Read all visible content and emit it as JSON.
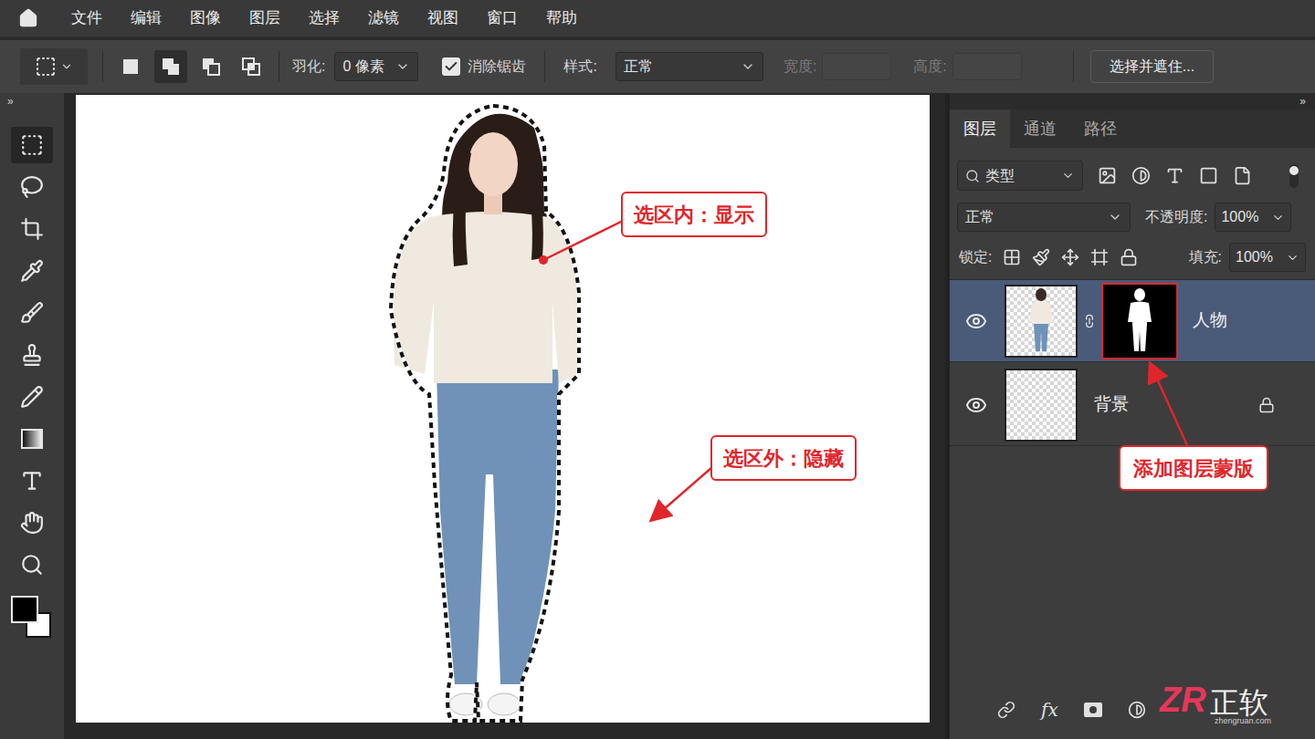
{
  "menu_items": [
    "文件",
    "编辑",
    "图像",
    "图层",
    "选择",
    "滤镜",
    "视图",
    "窗口",
    "帮助"
  ],
  "collapse_glyph": "»",
  "options_bar": {
    "modes": [
      {
        "kind": "new",
        "selected": false
      },
      {
        "kind": "add",
        "selected": true
      },
      {
        "kind": "subtract",
        "selected": false
      },
      {
        "kind": "intersect",
        "selected": false
      }
    ],
    "feather_label": "羽化:",
    "feather_value": "0 像素",
    "antialias": {
      "label": "消除锯齿",
      "checked": true
    },
    "style_label": "样式:",
    "style_value": "正常",
    "width_label": "宽度:",
    "width_disabled": true,
    "height_label": "高度:",
    "height_disabled": true,
    "button": "选择并遮住..."
  },
  "tools": [
    {
      "kind": "marquee",
      "selected": true
    },
    {
      "kind": "lasso",
      "selected": false
    },
    {
      "kind": "crop",
      "selected": false
    },
    {
      "kind": "eyedropper",
      "selected": false
    },
    {
      "kind": "brush",
      "selected": false
    },
    {
      "kind": "stamp",
      "selected": false
    },
    {
      "kind": "pencil",
      "selected": false
    },
    {
      "kind": "gradient",
      "selected": false
    },
    {
      "kind": "type",
      "selected": false
    },
    {
      "kind": "hand",
      "selected": false
    },
    {
      "kind": "zoom",
      "selected": false
    }
  ],
  "swatches": {
    "foreground": "#000000",
    "background": "#ffffff"
  },
  "canvas": {
    "selection_active": true
  },
  "panel": {
    "tabs": [
      {
        "label": "图层",
        "selected": true
      },
      {
        "label": "通道",
        "selected": false
      },
      {
        "label": "路径",
        "selected": false
      }
    ],
    "filter": "类型",
    "blend_mode": "正常",
    "opacity_label": "不透明度:",
    "opacity": "100%",
    "lock_label": "锁定:",
    "fill_label": "填充:",
    "fill": "100%",
    "bottom_fx": "fx"
  },
  "layers": [
    {
      "name": "人物",
      "selected": true,
      "visible": true,
      "locked": false,
      "has_mask": true,
      "mask_highlighted": true
    },
    {
      "name": "背景",
      "selected": false,
      "visible": true,
      "locked": true,
      "has_mask": false,
      "mask_highlighted": false
    }
  ],
  "annotations": {
    "inside": "选区内：显示",
    "outside": "选区外：隐藏",
    "mask": "添加图层蒙版"
  },
  "watermark": {
    "logo": "ZR",
    "name": "正软",
    "url": "zhengruan.com"
  }
}
